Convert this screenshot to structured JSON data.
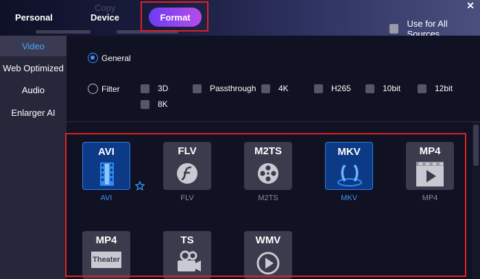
{
  "topbar": {
    "tabs": {
      "personal": "Personal",
      "device": "Device",
      "format": "Format"
    },
    "background_text": "Copy",
    "use_all_sources_label": "Use for All Sources",
    "close_glyph": "✕"
  },
  "sidebar": {
    "items": [
      {
        "label": "Video",
        "active": true
      },
      {
        "label": "Web Optimized"
      },
      {
        "label": "Audio"
      },
      {
        "label": "Enlarger AI"
      }
    ]
  },
  "options": {
    "general_label": "General",
    "filter_label": "Filter",
    "filters": [
      "3D",
      "Passthrough",
      "4K",
      "H265",
      "10bit",
      "12bit",
      "8K"
    ]
  },
  "formats": [
    {
      "title": "AVI",
      "caption": "AVI",
      "icon": "film-strip-icon",
      "highlighted": true,
      "starred": true
    },
    {
      "title": "FLV",
      "caption": "FLV",
      "icon": "flash-icon"
    },
    {
      "title": "M2TS",
      "caption": "M2TS",
      "icon": "film-reel-icon"
    },
    {
      "title": "MKV",
      "caption": "MKV",
      "icon": "matroska-icon",
      "highlighted": true
    },
    {
      "title": "MP4",
      "caption": "MP4",
      "icon": "video-play-icon"
    },
    {
      "title": "MP4",
      "caption": "",
      "icon": "theater-icon",
      "icon_text": "Theater"
    },
    {
      "title": "TS",
      "caption": "",
      "icon": "video-camera-icon"
    },
    {
      "title": "WMV",
      "caption": "",
      "icon": "play-circle-icon"
    }
  ],
  "colors": {
    "accent_blue": "#3a96ff",
    "format_pill": "#8a42ee",
    "highlight_outline": "#e02222",
    "tile_bg": "#3a3b4c",
    "tile_selected_bg": "#0d3a86"
  }
}
